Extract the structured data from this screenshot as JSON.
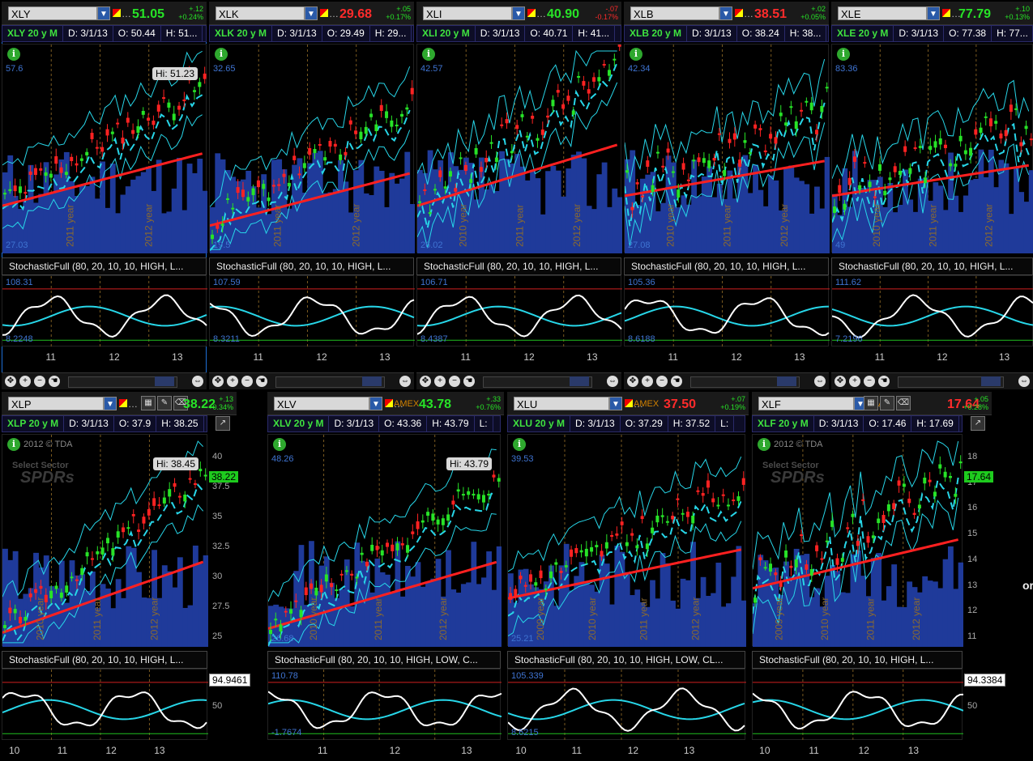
{
  "panels": [
    {
      "symbol": "XLY",
      "exchange": "",
      "price": "51.05",
      "change": "+.12",
      "change_pct": "+0.24%",
      "trend": "up",
      "info": {
        "title": "XLY 20 y M",
        "date": "D: 3/1/13",
        "open": "O: 50.44",
        "high": "H: 51..."
      },
      "stoch_label": "StochasticFull (80, 20, 10, 10, HIGH, L...",
      "y_top": "57.6",
      "y_bottom": "27.03",
      "stoch_top": "108.31",
      "stoch_bottom": "8.2248",
      "hi_label": "Hi: 51.23",
      "x_labels": [
        "11",
        "12",
        "13"
      ],
      "year_labels": [
        "2011 year",
        "2012 year"
      ]
    },
    {
      "symbol": "XLK",
      "exchange": "",
      "price": "29.68",
      "change": "+.05",
      "change_pct": "+0.17%",
      "trend": "down",
      "info": {
        "title": "XLK 20 y M",
        "date": "D: 3/1/13",
        "open": "O: 29.49",
        "high": "H: 29..."
      },
      "stoch_label": "StochasticFull (80, 20, 10, 10, HIGH, L...",
      "y_top": "32.65",
      "y_bottom": "19.5",
      "stoch_top": "107.59",
      "stoch_bottom": "8.3211",
      "x_labels": [
        "11",
        "12",
        "13"
      ],
      "year_labels": [
        "2011 year",
        "2012 year"
      ]
    },
    {
      "symbol": "XLI",
      "exchange": "",
      "price": "40.90",
      "change": "-.07",
      "change_pct": "-0.17%",
      "trend": "up",
      "info": {
        "title": "XLI 20 y M",
        "date": "D: 3/1/13",
        "open": "O: 40.71",
        "high": "H: 41..."
      },
      "stoch_label": "StochasticFull (80, 20, 10, 10, HIGH, L...",
      "y_top": "42.57",
      "y_bottom": "26.02",
      "stoch_top": "106.71",
      "stoch_bottom": "8.4387",
      "x_labels": [
        "11",
        "12",
        "13"
      ],
      "year_labels": [
        "2010 year",
        "2011 year",
        "2012 year"
      ]
    },
    {
      "symbol": "XLB",
      "exchange": "",
      "price": "38.51",
      "change": "+.02",
      "change_pct": "+0.05%",
      "trend": "down",
      "info": {
        "title": "XLB 20 y M",
        "date": "D: 3/1/13",
        "open": "O: 38.24",
        "high": "H: 38..."
      },
      "stoch_label": "StochasticFull (80, 20, 10, 10, HIGH, L...",
      "y_top": "42.34",
      "y_bottom": "27.08",
      "stoch_top": "105.36",
      "stoch_bottom": "8.6188",
      "x_labels": [
        "11",
        "12",
        "13"
      ],
      "year_labels": [
        "2010 year",
        "2011 year",
        "2012 year"
      ]
    },
    {
      "symbol": "XLE",
      "exchange": "",
      "price": "77.79",
      "change": "+.10",
      "change_pct": "+0.13%",
      "trend": "up",
      "info": {
        "title": "XLE 20 y M",
        "date": "D: 3/1/13",
        "open": "O: 77.38",
        "high": "H: 77..."
      },
      "stoch_label": "StochasticFull (80, 20, 10, 10, HIGH, L...",
      "y_top": "83.36",
      "y_bottom": "49",
      "stoch_top": "111.62",
      "stoch_bottom": "7.2196",
      "x_labels": [
        "11",
        "12",
        "13"
      ],
      "year_labels": [
        "2010 year",
        "2011 year",
        "2012 year"
      ]
    },
    {
      "symbol": "XLP",
      "exchange": "",
      "price": "38.22",
      "change": "+.13",
      "change_pct": "+0.34%",
      "trend": "up",
      "info": {
        "title": "XLP 20 y M",
        "date": "D: 3/1/13",
        "open": "O: 37.9",
        "high": "H: 38.25"
      },
      "stoch_label": "StochasticFull (80, 20, 10, 10, HIGH, L...",
      "hi_label": "Hi: 38.45",
      "last_label": "38.22",
      "stoch_value": "94.9461",
      "y_ticks": [
        "40",
        "37.5",
        "35",
        "32.5",
        "30",
        "27.5",
        "25"
      ],
      "stoch_ticks": [
        "50"
      ],
      "copyright": "2012 © TDA",
      "brand1": "Select Sector",
      "brand2": "SPDRs",
      "x_labels": [
        "10",
        "11",
        "12",
        "13"
      ],
      "year_labels": [
        "2010 year",
        "2011 year",
        "2012 year"
      ]
    },
    {
      "symbol": "XLV",
      "exchange": "AMEX",
      "price": "43.78",
      "change": "+.33",
      "change_pct": "+0.76%",
      "trend": "up",
      "info": {
        "title": "XLV 20 y M",
        "date": "D: 3/1/13",
        "open": "O: 43.36",
        "high": "H: 43.79",
        "low": "L:"
      },
      "stoch_label": "StochasticFull (80, 20, 10, 10, HIGH, LOW, C...",
      "hi_label": "Hi: 43.79",
      "y_top": "48.26",
      "y_bottom": "26.68",
      "stoch_top": "110.78",
      "stoch_bottom": "-1.7674",
      "x_labels": [
        "11",
        "12",
        "13"
      ],
      "year_labels": [
        "2010 year",
        "2011 year",
        "2012 year"
      ]
    },
    {
      "symbol": "XLU",
      "exchange": "AMEX",
      "price": "37.50",
      "change": "+.07",
      "change_pct": "+0.19%",
      "trend": "down",
      "info": {
        "title": "XLU 20 y M",
        "date": "D: 3/1/13",
        "open": "O: 37.29",
        "high": "H: 37.52",
        "low": "L:"
      },
      "stoch_label": "StochasticFull (80, 20, 10, 10, HIGH, LOW, CL...",
      "y_top": "39.53",
      "y_bottom": "25.21",
      "stoch_top": "105.339",
      "stoch_bottom": "8.6215",
      "x_labels": [
        "10",
        "11",
        "12",
        "13"
      ],
      "year_labels": [
        "2009 year",
        "2010 year",
        "2011 year",
        "2012 year"
      ]
    },
    {
      "symbol": "XLF",
      "exchange": "A",
      "price": "17.64",
      "change": "+.05",
      "change_pct": "+0.28%",
      "trend": "down",
      "info": {
        "title": "XLF 20 y M",
        "date": "D: 3/1/13",
        "open": "O: 17.46",
        "high": "H: 17.69"
      },
      "stoch_label": "StochasticFull (80, 20, 10, 10, HIGH, L...",
      "last_label": "17.64",
      "stoch_value": "94.3384",
      "y_ticks": [
        "18",
        "17",
        "16",
        "15",
        "14",
        "13",
        "12",
        "11"
      ],
      "stoch_ticks": [
        "50"
      ],
      "copyright": "2012 © TDA",
      "brand1": "Select Sector",
      "brand2": "SPDRs",
      "x_labels": [
        "10",
        "11",
        "12",
        "13"
      ],
      "year_labels": [
        "2009 year",
        "2010 year",
        "2011 year",
        "2012 year"
      ]
    }
  ],
  "side_text": "or",
  "colors": {
    "bull": "#27e327",
    "bear": "#ff2222",
    "ma_slow": "#ff2020",
    "ma_fast": "#27d6e8",
    "volume": "#1f3a9a",
    "stoch_k": "#ffffff",
    "stoch_d": "#27d6e8"
  }
}
